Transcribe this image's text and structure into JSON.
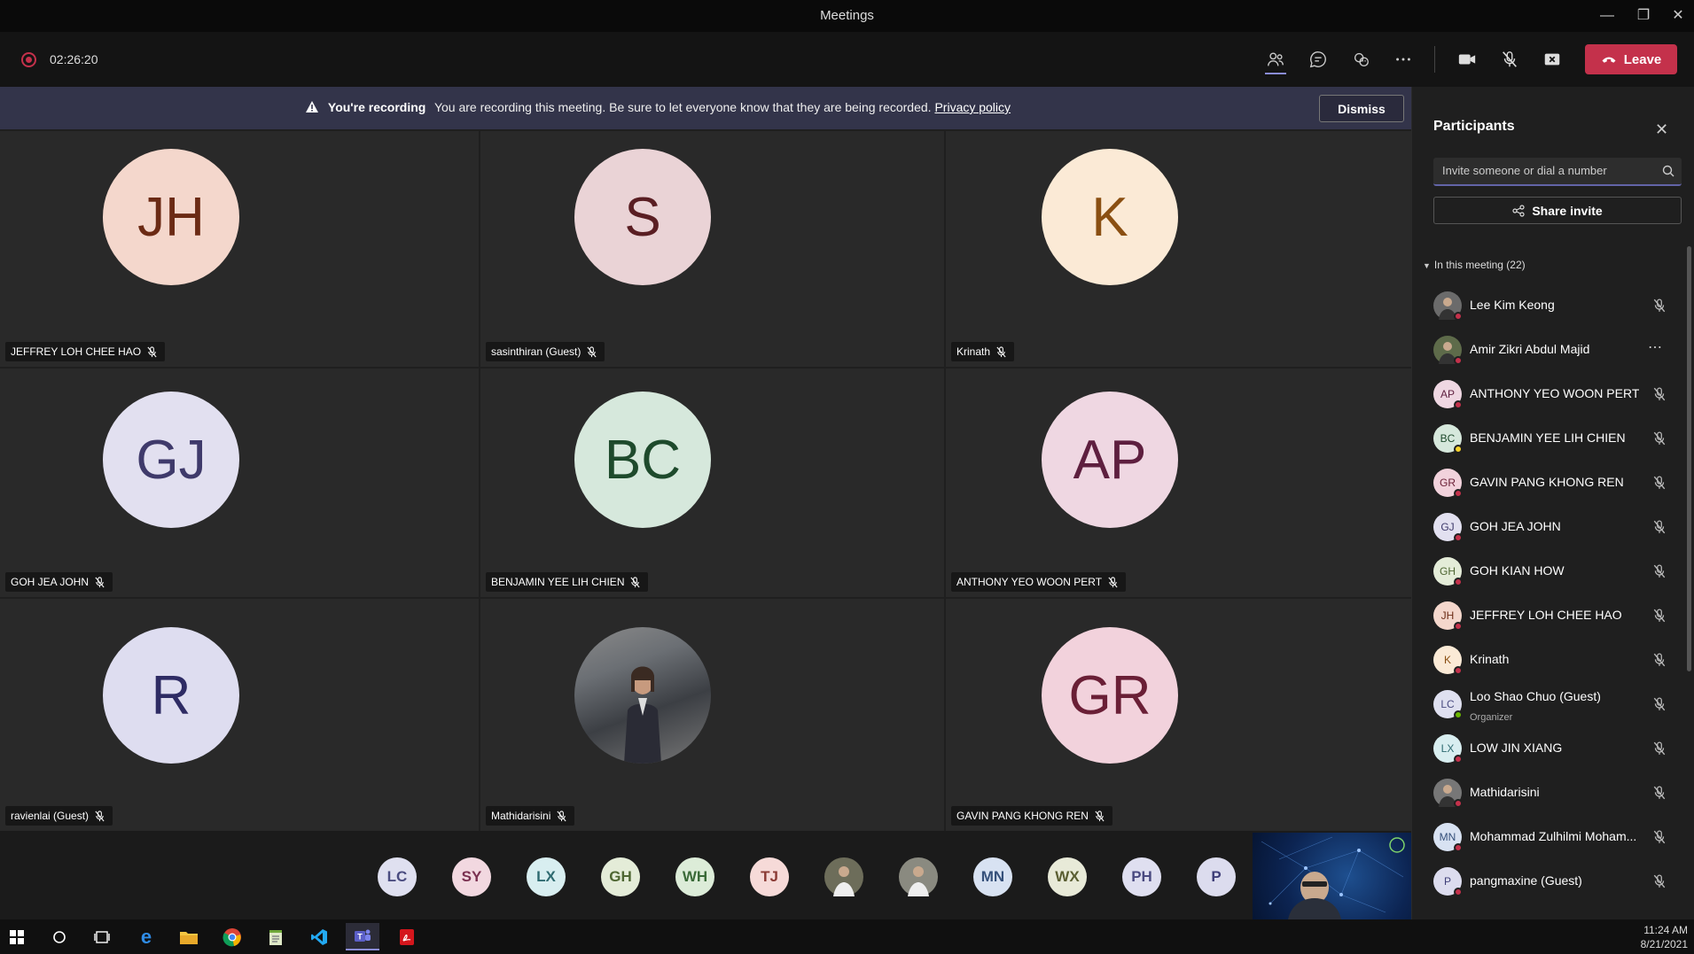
{
  "window": {
    "title": "Meetings"
  },
  "toolbar": {
    "timer": "02:26:20",
    "leave_label": "Leave"
  },
  "banner": {
    "title": "You're recording",
    "message": "You are recording this meeting. Be sure to let everyone know that they are being recorded.",
    "link": "Privacy policy",
    "dismiss": "Dismiss"
  },
  "tiles": [
    {
      "initials": "JH",
      "name": "JEFFREY LOH CHEE HAO",
      "bg": "#f4d7cc",
      "fg": "#6b2a14"
    },
    {
      "initials": "S",
      "name": "sasinthiran (Guest)",
      "bg": "#ead3d6",
      "fg": "#5a1e23"
    },
    {
      "initials": "K",
      "name": "Krinath",
      "bg": "#fbead6",
      "fg": "#8a4f12"
    },
    {
      "initials": "GJ",
      "name": "GOH JEA JOHN",
      "bg": "#e2e0f0",
      "fg": "#3f3a6b"
    },
    {
      "initials": "BC",
      "name": "BENJAMIN YEE LIH CHIEN",
      "bg": "#d6e8dc",
      "fg": "#1e4a2c"
    },
    {
      "initials": "AP",
      "name": "ANTHONY YEO WOON PERT",
      "bg": "#efd7e2",
      "fg": "#5e1f3f"
    },
    {
      "initials": "R",
      "name": "ravienlai (Guest)",
      "bg": "#deddf0",
      "fg": "#2e2b64"
    },
    {
      "initials": "",
      "name": "Mathidarisini",
      "bg": "#777",
      "fg": "#fff"
    },
    {
      "initials": "GR",
      "name": "GAVIN PANG KHONG REN",
      "bg": "#f2d2dc",
      "fg": "#6a1f36"
    }
  ],
  "strip": [
    {
      "initials": "LC",
      "bg": "#dfe0f0",
      "fg": "#4a4c80"
    },
    {
      "initials": "SY",
      "bg": "#f2d8e0",
      "fg": "#7a3050"
    },
    {
      "initials": "LX",
      "bg": "#d8eef0",
      "fg": "#2e6a70"
    },
    {
      "initials": "GH",
      "bg": "#e4ecd8",
      "fg": "#4e6632"
    },
    {
      "initials": "WH",
      "bg": "#dcecd8",
      "fg": "#3a6a38"
    },
    {
      "initials": "TJ",
      "bg": "#f6dad8",
      "fg": "#8a3a34"
    },
    {
      "initials": "",
      "bg": "#6d6d5a",
      "fg": "#fff"
    },
    {
      "initials": "",
      "bg": "#8a8a80",
      "fg": "#fff"
    },
    {
      "initials": "MN",
      "bg": "#d8e2f2",
      "fg": "#35507a"
    },
    {
      "initials": "WX",
      "bg": "#e8ead8",
      "fg": "#5a5e32"
    },
    {
      "initials": "PH",
      "bg": "#dfdff0",
      "fg": "#4a4a80"
    },
    {
      "initials": "P",
      "bg": "#dcdcee",
      "fg": "#3e3e78"
    }
  ],
  "panel": {
    "title": "Participants",
    "invite_placeholder": "Invite someone or dial a number",
    "share_invite": "Share invite",
    "in_meeting": "In this meeting (22)",
    "participants": [
      {
        "initials": "",
        "name": "Lee Kim Keong",
        "role": "",
        "bg": "#6b6b6b",
        "fg": "#fff",
        "status": "#c4314b",
        "action": "mic-off-icon"
      },
      {
        "initials": "",
        "name": "Amir Zikri Abdul Majid",
        "role": "",
        "bg": "#5e6b4a",
        "fg": "#fff",
        "status": "#c4314b",
        "action": "more-icon"
      },
      {
        "initials": "AP",
        "name": "ANTHONY YEO WOON PERT",
        "role": "",
        "bg": "#efd7e2",
        "fg": "#5e1f3f",
        "status": "#c4314b",
        "action": "mic-off-icon"
      },
      {
        "initials": "BC",
        "name": "BENJAMIN YEE LIH CHIEN",
        "role": "",
        "bg": "#d6e8dc",
        "fg": "#1e4a2c",
        "status": "#f8d22a",
        "action": "mic-off-icon"
      },
      {
        "initials": "GR",
        "name": "GAVIN PANG KHONG REN",
        "role": "",
        "bg": "#f2d2dc",
        "fg": "#6a1f36",
        "status": "#c4314b",
        "action": "mic-off-icon"
      },
      {
        "initials": "GJ",
        "name": "GOH JEA JOHN",
        "role": "",
        "bg": "#e2e0f0",
        "fg": "#3f3a6b",
        "status": "#c4314b",
        "action": "mic-off-icon"
      },
      {
        "initials": "GH",
        "name": "GOH KIAN HOW",
        "role": "",
        "bg": "#e4ecd8",
        "fg": "#4e6632",
        "status": "#c4314b",
        "action": "mic-off-icon"
      },
      {
        "initials": "JH",
        "name": "JEFFREY LOH CHEE HAO",
        "role": "",
        "bg": "#f4d7cc",
        "fg": "#6b2a14",
        "status": "#c4314b",
        "action": "mic-off-icon"
      },
      {
        "initials": "K",
        "name": "Krinath",
        "role": "",
        "bg": "#fbead6",
        "fg": "#8a4f12",
        "status": "#c4314b",
        "action": "mic-off-icon"
      },
      {
        "initials": "LC",
        "name": "Loo Shao Chuo (Guest)",
        "role": "Organizer",
        "bg": "#dfe0f0",
        "fg": "#4a4c80",
        "status": "#6bb700",
        "action": "mic-off-icon"
      },
      {
        "initials": "LX",
        "name": "LOW JIN XIANG",
        "role": "",
        "bg": "#d8eef0",
        "fg": "#2e6a70",
        "status": "#c4314b",
        "action": "mic-off-icon"
      },
      {
        "initials": "",
        "name": "Mathidarisini",
        "role": "",
        "bg": "#777",
        "fg": "#fff",
        "status": "#c4314b",
        "action": "mic-off-icon"
      },
      {
        "initials": "MN",
        "name": "Mohammad Zulhilmi Moham...",
        "role": "",
        "bg": "#d8e2f2",
        "fg": "#35507a",
        "status": "#c4314b",
        "action": "mic-off-icon"
      },
      {
        "initials": "P",
        "name": "pangmaxine (Guest)",
        "role": "",
        "bg": "#dcdcee",
        "fg": "#3e3e78",
        "status": "#c4314b",
        "action": "mic-off-icon"
      }
    ]
  },
  "taskbar": {
    "time": "11:24 AM",
    "date": "8/21/2021"
  },
  "colors": {
    "accent": "#6264a7",
    "leave": "#c4314b",
    "banner": "#33344a"
  }
}
